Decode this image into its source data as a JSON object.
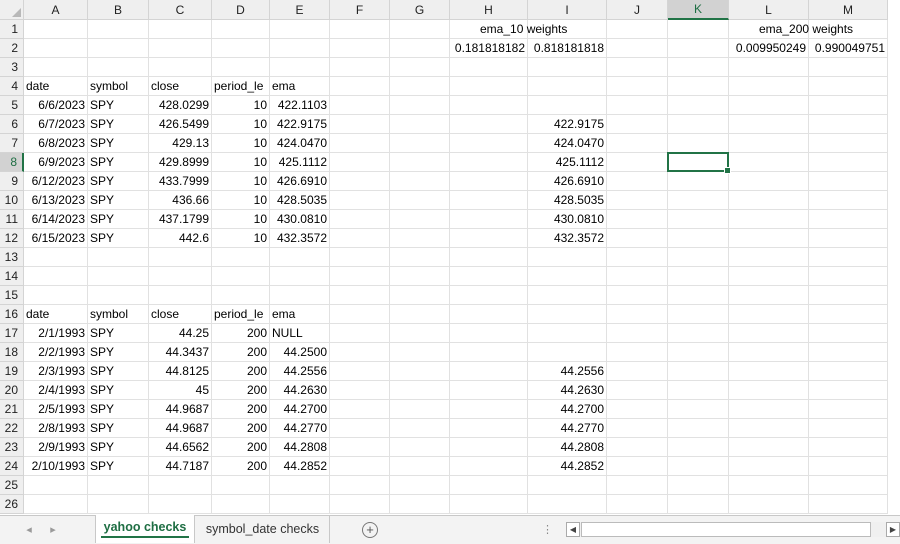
{
  "sheet": {
    "columns": [
      "A",
      "B",
      "C",
      "D",
      "E",
      "F",
      "G",
      "H",
      "I",
      "J",
      "K",
      "L",
      "M"
    ],
    "rows": [
      "1",
      "2",
      "3",
      "4",
      "5",
      "6",
      "7",
      "8",
      "9",
      "10",
      "11",
      "12",
      "13",
      "14",
      "15",
      "16",
      "17",
      "18",
      "19",
      "20",
      "21",
      "22",
      "23",
      "24",
      "25",
      "26"
    ],
    "selected_column": "K",
    "selected_row": "8",
    "cells": {
      "H1": "ema_10 weights",
      "H2": "0.181818182",
      "I2": "0.818181818",
      "L1": "ema_200 weights",
      "L2": "0.009950249",
      "M2": "0.990049751",
      "A4": "date",
      "B4": "symbol",
      "C4": "close",
      "D4": "period_le",
      "E4": "ema",
      "A5": "6/6/2023",
      "B5": "SPY",
      "C5": "428.0299",
      "D5": "10",
      "E5": "422.1103",
      "A6": "6/7/2023",
      "B6": "SPY",
      "C6": "426.5499",
      "D6": "10",
      "E6": "422.9175",
      "I6": "422.9175",
      "A7": "6/8/2023",
      "B7": "SPY",
      "C7": "429.13",
      "D7": "10",
      "E7": "424.0470",
      "I7": "424.0470",
      "A8": "6/9/2023",
      "B8": "SPY",
      "C8": "429.8999",
      "D8": "10",
      "E8": "425.1112",
      "I8": "425.1112",
      "A9": "6/12/2023",
      "B9": "SPY",
      "C9": "433.7999",
      "D9": "10",
      "E9": "426.6910",
      "I9": "426.6910",
      "A10": "6/13/2023",
      "B10": "SPY",
      "C10": "436.66",
      "D10": "10",
      "E10": "428.5035",
      "I10": "428.5035",
      "A11": "6/14/2023",
      "B11": "SPY",
      "C11": "437.1799",
      "D11": "10",
      "E11": "430.0810",
      "I11": "430.0810",
      "A12": "6/15/2023",
      "B12": "SPY",
      "C12": "442.6",
      "D12": "10",
      "E12": "432.3572",
      "I12": "432.3572",
      "A16": "date",
      "B16": "symbol",
      "C16": "close",
      "D16": "period_le",
      "E16": "ema",
      "A17": "2/1/1993",
      "B17": "SPY",
      "C17": "44.25",
      "D17": "200",
      "E17": "NULL",
      "A18": "2/2/1993",
      "B18": "SPY",
      "C18": "44.3437",
      "D18": "200",
      "E18": "44.2500",
      "A19": "2/3/1993",
      "B19": "SPY",
      "C19": "44.8125",
      "D19": "200",
      "E19": "44.2556",
      "I19": "44.2556",
      "A20": "2/4/1993",
      "B20": "SPY",
      "C20": "45",
      "D20": "200",
      "E20": "44.2630",
      "I20": "44.2630",
      "A21": "2/5/1993",
      "B21": "SPY",
      "C21": "44.9687",
      "D21": "200",
      "E21": "44.2700",
      "I21": "44.2700",
      "A22": "2/8/1993",
      "B22": "SPY",
      "C22": "44.9687",
      "D22": "200",
      "E22": "44.2770",
      "I22": "44.2770",
      "A23": "2/9/1993",
      "B23": "SPY",
      "C23": "44.6562",
      "D23": "200",
      "E23": "44.2808",
      "I23": "44.2808",
      "A24": "2/10/1993",
      "B24": "SPY",
      "C24": "44.7187",
      "D24": "200",
      "E24": "44.2852",
      "I24": "44.2852"
    },
    "right_aligned": [
      "A5",
      "A6",
      "A7",
      "A8",
      "A9",
      "A10",
      "A11",
      "A12",
      "A17",
      "A18",
      "A19",
      "A20",
      "A21",
      "A22",
      "A23",
      "A24",
      "C5",
      "C6",
      "C7",
      "C8",
      "C9",
      "C10",
      "C11",
      "C12",
      "C17",
      "C18",
      "C19",
      "C20",
      "C21",
      "C22",
      "C23",
      "C24",
      "D5",
      "D6",
      "D7",
      "D8",
      "D9",
      "D10",
      "D11",
      "D12",
      "D17",
      "D18",
      "D19",
      "D20",
      "D21",
      "D22",
      "D23",
      "D24",
      "E5",
      "E6",
      "E7",
      "E8",
      "E9",
      "E10",
      "E11",
      "E12",
      "E18",
      "E19",
      "E20",
      "E21",
      "E22",
      "E23",
      "E24",
      "I6",
      "I7",
      "I8",
      "I9",
      "I10",
      "I11",
      "I12",
      "I19",
      "I20",
      "I21",
      "I22",
      "I23",
      "I24",
      "H2",
      "I2",
      "L2",
      "M2"
    ],
    "clipped": [
      "D4",
      "D16"
    ]
  },
  "tabs": {
    "prev_icon": "chevron-left-icon",
    "next_icon": "chevron-right-icon",
    "items": [
      {
        "label": "yahoo checks",
        "active": true
      },
      {
        "label": "symbol_date checks",
        "active": false
      }
    ],
    "add_icon": "+",
    "ellipsis": "⋮"
  },
  "colors": {
    "accent": "#217346",
    "header_bg": "#efefef",
    "gridline": "#e1e1e1"
  }
}
